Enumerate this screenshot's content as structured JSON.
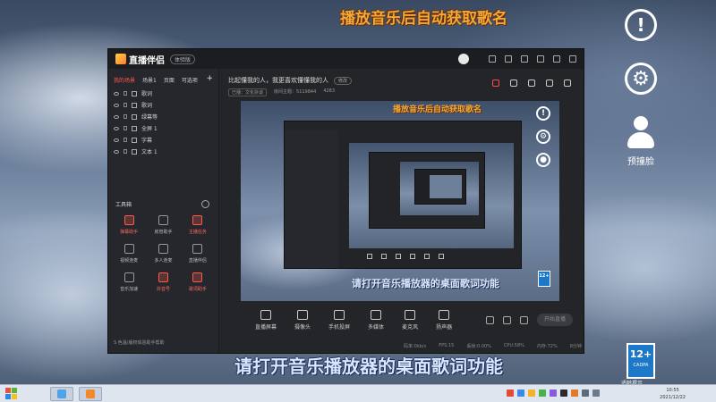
{
  "desktop": {
    "top_banner": "播放音乐后自动获取歌名",
    "right_avatar_label": "预撞脸",
    "bottom_subtitle": "请打开音乐播放器的桌面歌词功能",
    "age_badge": "12+",
    "age_badge_sub": "CADPA",
    "age_label": "适龄提示"
  },
  "app": {
    "brand": "直播伴侣",
    "version": "体验版",
    "tabs": [
      "我的场景",
      "场景1",
      "页面",
      "可选项"
    ],
    "layers": [
      {
        "name": "歌词",
        "icon": "text-icon"
      },
      {
        "name": "歌词",
        "icon": "text-icon"
      },
      {
        "name": "绿幕等",
        "icon": "image-icon"
      },
      {
        "name": "全屏 1",
        "icon": "screen-icon"
      },
      {
        "name": "字幕",
        "icon": "text-icon"
      },
      {
        "name": "文本 1",
        "icon": "text-icon"
      }
    ],
    "tools_title": "工具箱",
    "tools": [
      {
        "label": "弹幕助手",
        "hot": true
      },
      {
        "label": "房管助手",
        "hot": false
      },
      {
        "label": "主播任务",
        "hot": true
      },
      {
        "label": "视频连麦",
        "hot": false
      },
      {
        "label": "多人连麦",
        "hot": false
      },
      {
        "label": "直播伴侣",
        "hot": false
      },
      {
        "label": "音乐加速",
        "hot": false
      },
      {
        "label": "抖音号",
        "hot": true
      },
      {
        "label": "歌词助手",
        "hot": true
      }
    ],
    "sidebar_footer": "S 色温/版权体验助手帮助",
    "room_title": "比起懂我的人，我更喜欢懂懂我的人",
    "edit_label": "修改",
    "room_meta": [
      "已播：文化杂谈",
      "房间主题：5119844",
      "4283"
    ],
    "preview": {
      "banner": "播放音乐后自动获取歌名",
      "subtitle": "请打开音乐播放器的桌面歌词功能",
      "age": "12+"
    },
    "bottom_tools": [
      "直播屏幕",
      "摄像头",
      "手机投屏",
      "多媒体",
      "麦克风",
      "扬声器"
    ],
    "go_live": "开始直播",
    "status": [
      "码率:0kb/s",
      "FPS:15",
      "丢帧:0.00%",
      "CPU:58%",
      "内存:72%",
      "8分钟"
    ]
  },
  "taskbar": {
    "time": "10:55",
    "date": "2021/12/22"
  }
}
